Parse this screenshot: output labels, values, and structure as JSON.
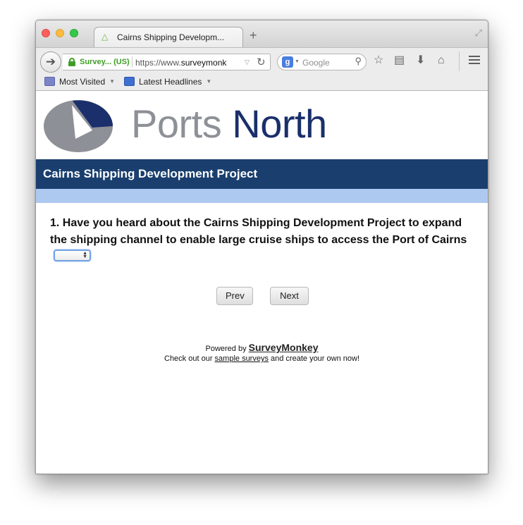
{
  "browser": {
    "tab_title": "Cairns Shipping Developm...",
    "new_tab": "+",
    "identity_label": "Survey...  (US)",
    "url_prefix": "https://www.",
    "url_domain": "surveymonk",
    "search_placeholder": "Google",
    "search_engine_letter": "g"
  },
  "bookmarks": [
    {
      "label": "Most Visited"
    },
    {
      "label": "Latest Headlines"
    }
  ],
  "logo": {
    "word1": "Ports",
    "word2": "North",
    "colors": {
      "grey": "#8e9097",
      "navy": "#1a2f6b"
    }
  },
  "survey": {
    "title": "Cairns Shipping Development Project",
    "question": "1. Have you heard about the Cairns Shipping Development Project to expand the shipping channel to enable large cruise ships to access the Port of Cairns",
    "answer_value": "",
    "prev_label": "Prev",
    "next_label": "Next"
  },
  "footer": {
    "powered_prefix": "Powered by",
    "brand": "SurveyMonkey",
    "checkout_prefix": "Check out our",
    "checkout_link": "sample surveys",
    "checkout_suffix": "and create your own now!"
  },
  "colors": {
    "banner": "#1a3f6e",
    "progress": "#adc9ef",
    "secure_green": "#3f9d26"
  }
}
